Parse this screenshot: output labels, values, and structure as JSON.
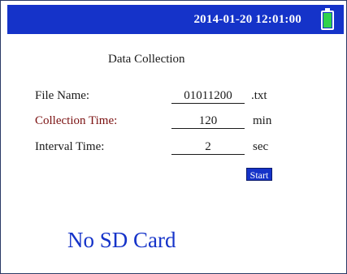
{
  "status_bar": {
    "datetime": "2014-01-20 12:01:00",
    "battery_icon": "battery-full-icon",
    "battery_level": 1.0,
    "bar_color": "#1533c9",
    "battery_fill_color": "#2fd24a"
  },
  "panel": {
    "title": "Data Collection",
    "fields": [
      {
        "label": "File Name:",
        "value": "01011200",
        "unit": ".txt"
      },
      {
        "label": "Collection Time:",
        "value": "120",
        "unit": "min"
      },
      {
        "label": "Interval Time:",
        "value": "2",
        "unit": "sec"
      }
    ],
    "start_label": "Start"
  },
  "sd_status": "No SD Card",
  "colors": {
    "accent": "#1533c9",
    "label_highlight": "#7a1010"
  }
}
